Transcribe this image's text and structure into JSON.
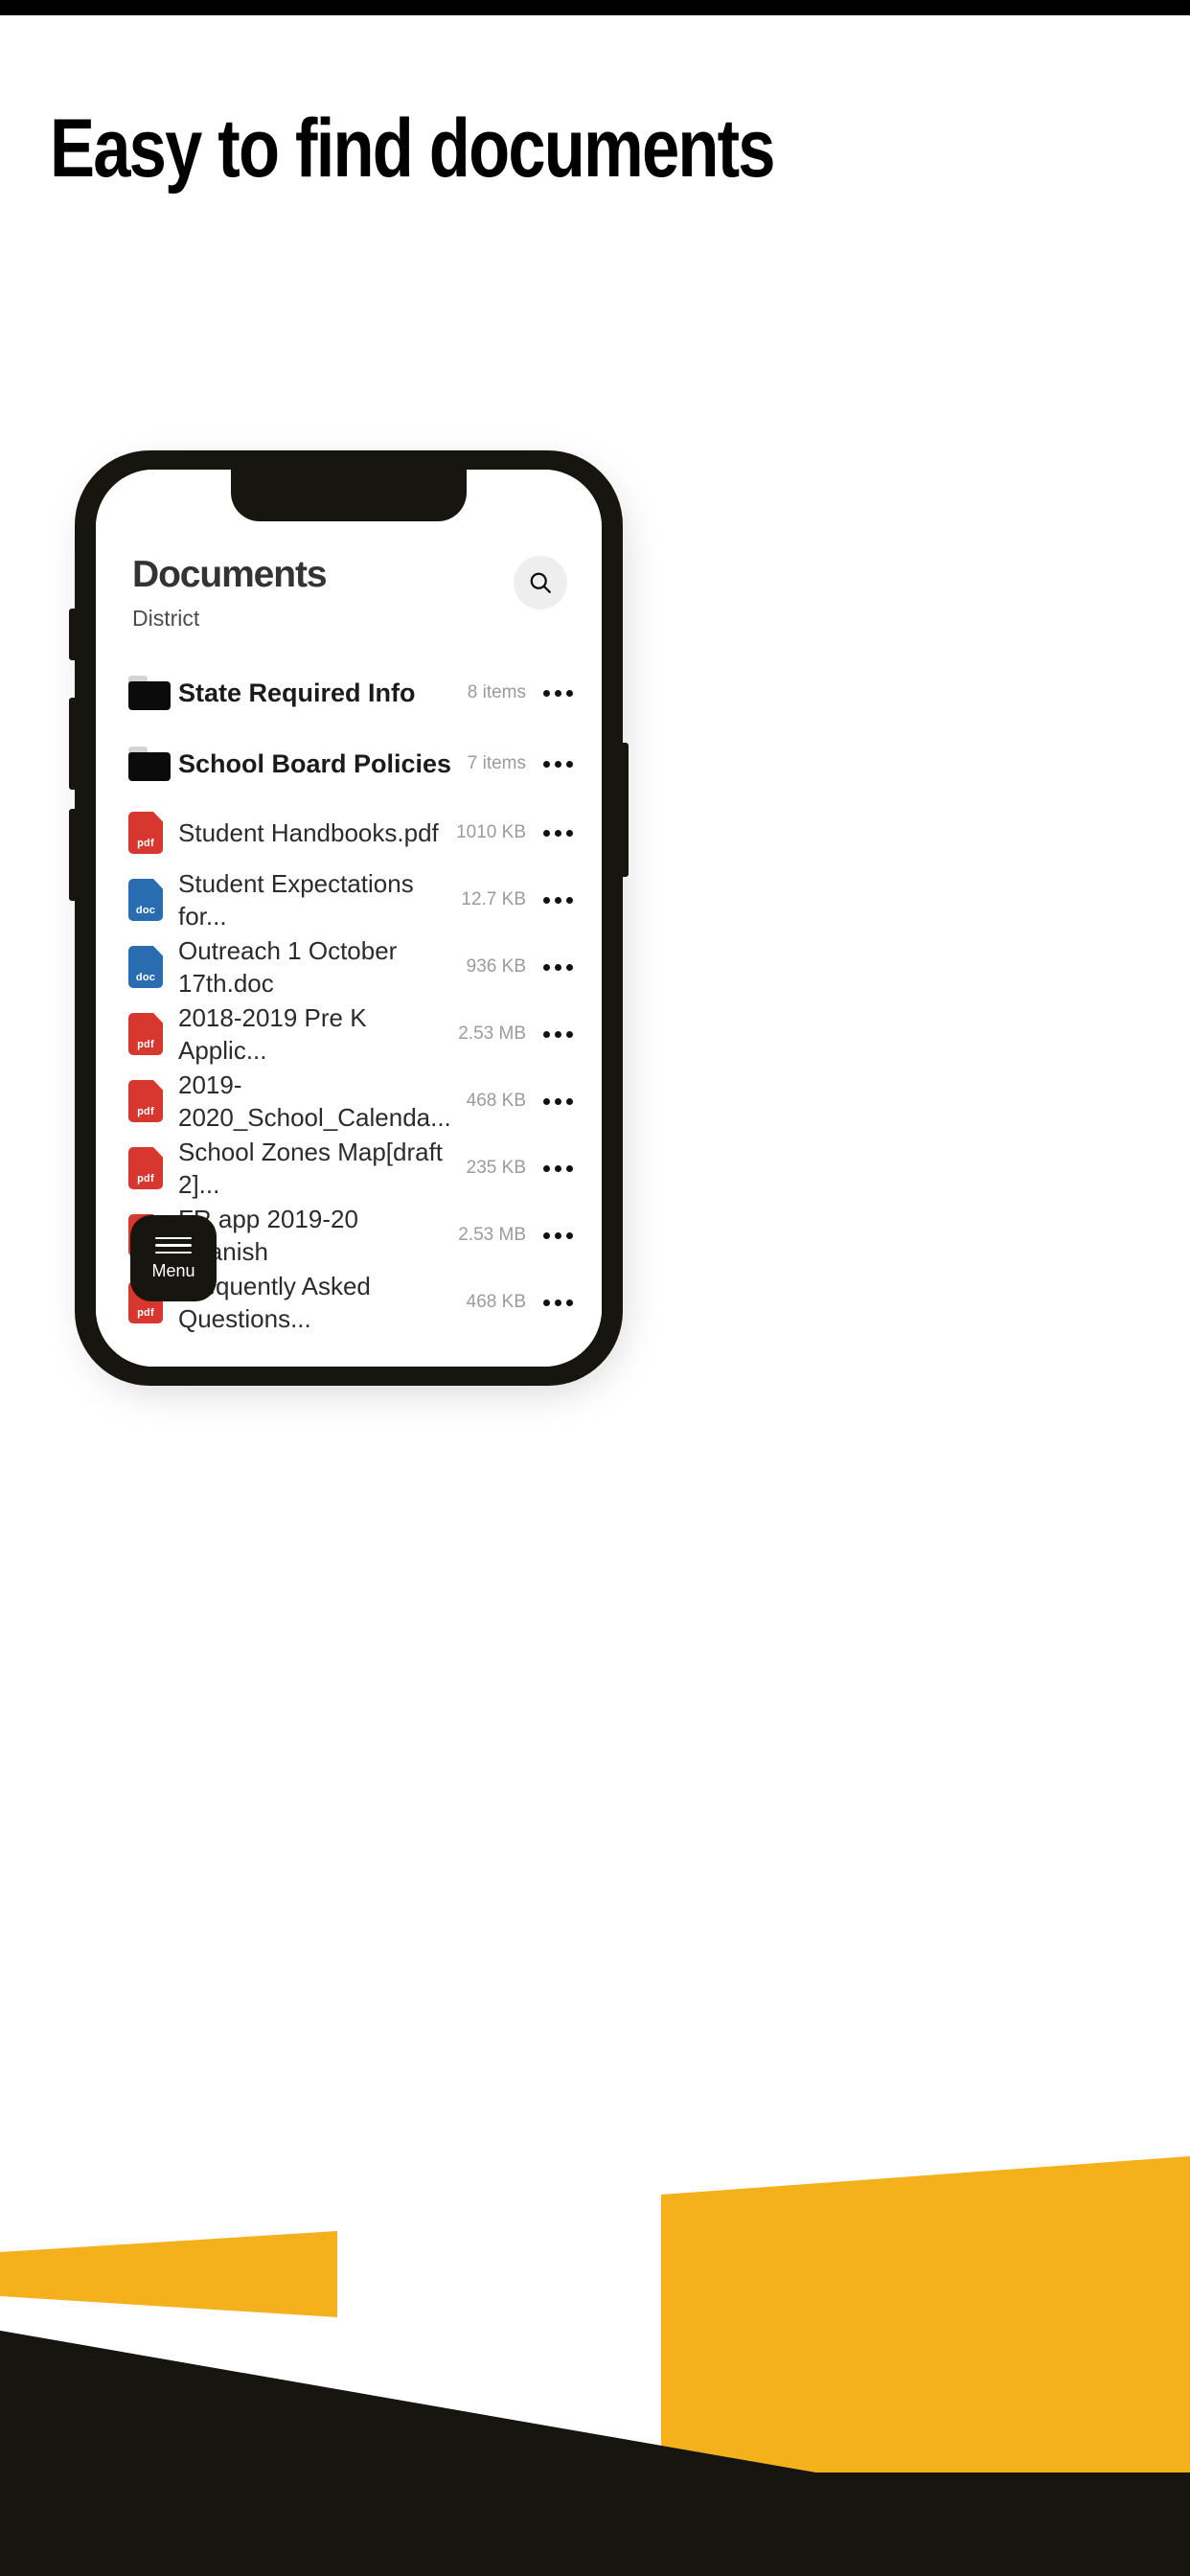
{
  "headline": "Easy to find documents",
  "colors": {
    "accent_yellow": "#F5B11B",
    "dark": "#17150F",
    "pdf_red": "#D8372F",
    "doc_blue": "#2A6CB0",
    "title_gray": "#333333",
    "meta_gray": "#9B9B9B",
    "search_bg": "#EEEEEE"
  },
  "app": {
    "title": "Documents",
    "subtitle": "District",
    "search": {
      "icon": "search-icon",
      "label": "Search"
    },
    "menu": {
      "icon": "hamburger-icon",
      "label": "Menu"
    },
    "more_icon": "ellipsis-icon",
    "items": [
      {
        "type": "folder",
        "icon": "folder-icon",
        "name": "State Required Info",
        "meta": "8 items"
      },
      {
        "type": "folder",
        "icon": "folder-icon",
        "name": "School Board Policies",
        "meta": "7 items"
      },
      {
        "type": "file",
        "icon": "pdf-file-icon",
        "badge": "pdf",
        "name": "Student Handbooks.pdf",
        "meta": "1010 KB"
      },
      {
        "type": "file",
        "icon": "doc-file-icon",
        "badge": "doc",
        "name": "Student Expectations for...",
        "meta": "12.7 KB"
      },
      {
        "type": "file",
        "icon": "doc-file-icon",
        "badge": "doc",
        "name": "Outreach 1 October 17th.doc",
        "meta": "936 KB"
      },
      {
        "type": "file",
        "icon": "pdf-file-icon",
        "badge": "pdf",
        "name": "2018-2019 Pre K Applic...",
        "meta": "2.53 MB"
      },
      {
        "type": "file",
        "icon": "pdf-file-icon",
        "badge": "pdf",
        "name": "2019-2020_School_Calenda...",
        "meta": "468 KB"
      },
      {
        "type": "file",
        "icon": "pdf-file-icon",
        "badge": "pdf",
        "name": "School Zones Map[draft 2]...",
        "meta": "235 KB"
      },
      {
        "type": "file",
        "icon": "pdf-file-icon",
        "badge": "pdf",
        "name": "FR app 2019-20 Spanish",
        "meta": "2.53 MB"
      },
      {
        "type": "file",
        "icon": "pdf-file-icon",
        "badge": "pdf",
        "name": "Frequently Asked Questions...",
        "meta": "468 KB"
      }
    ]
  }
}
